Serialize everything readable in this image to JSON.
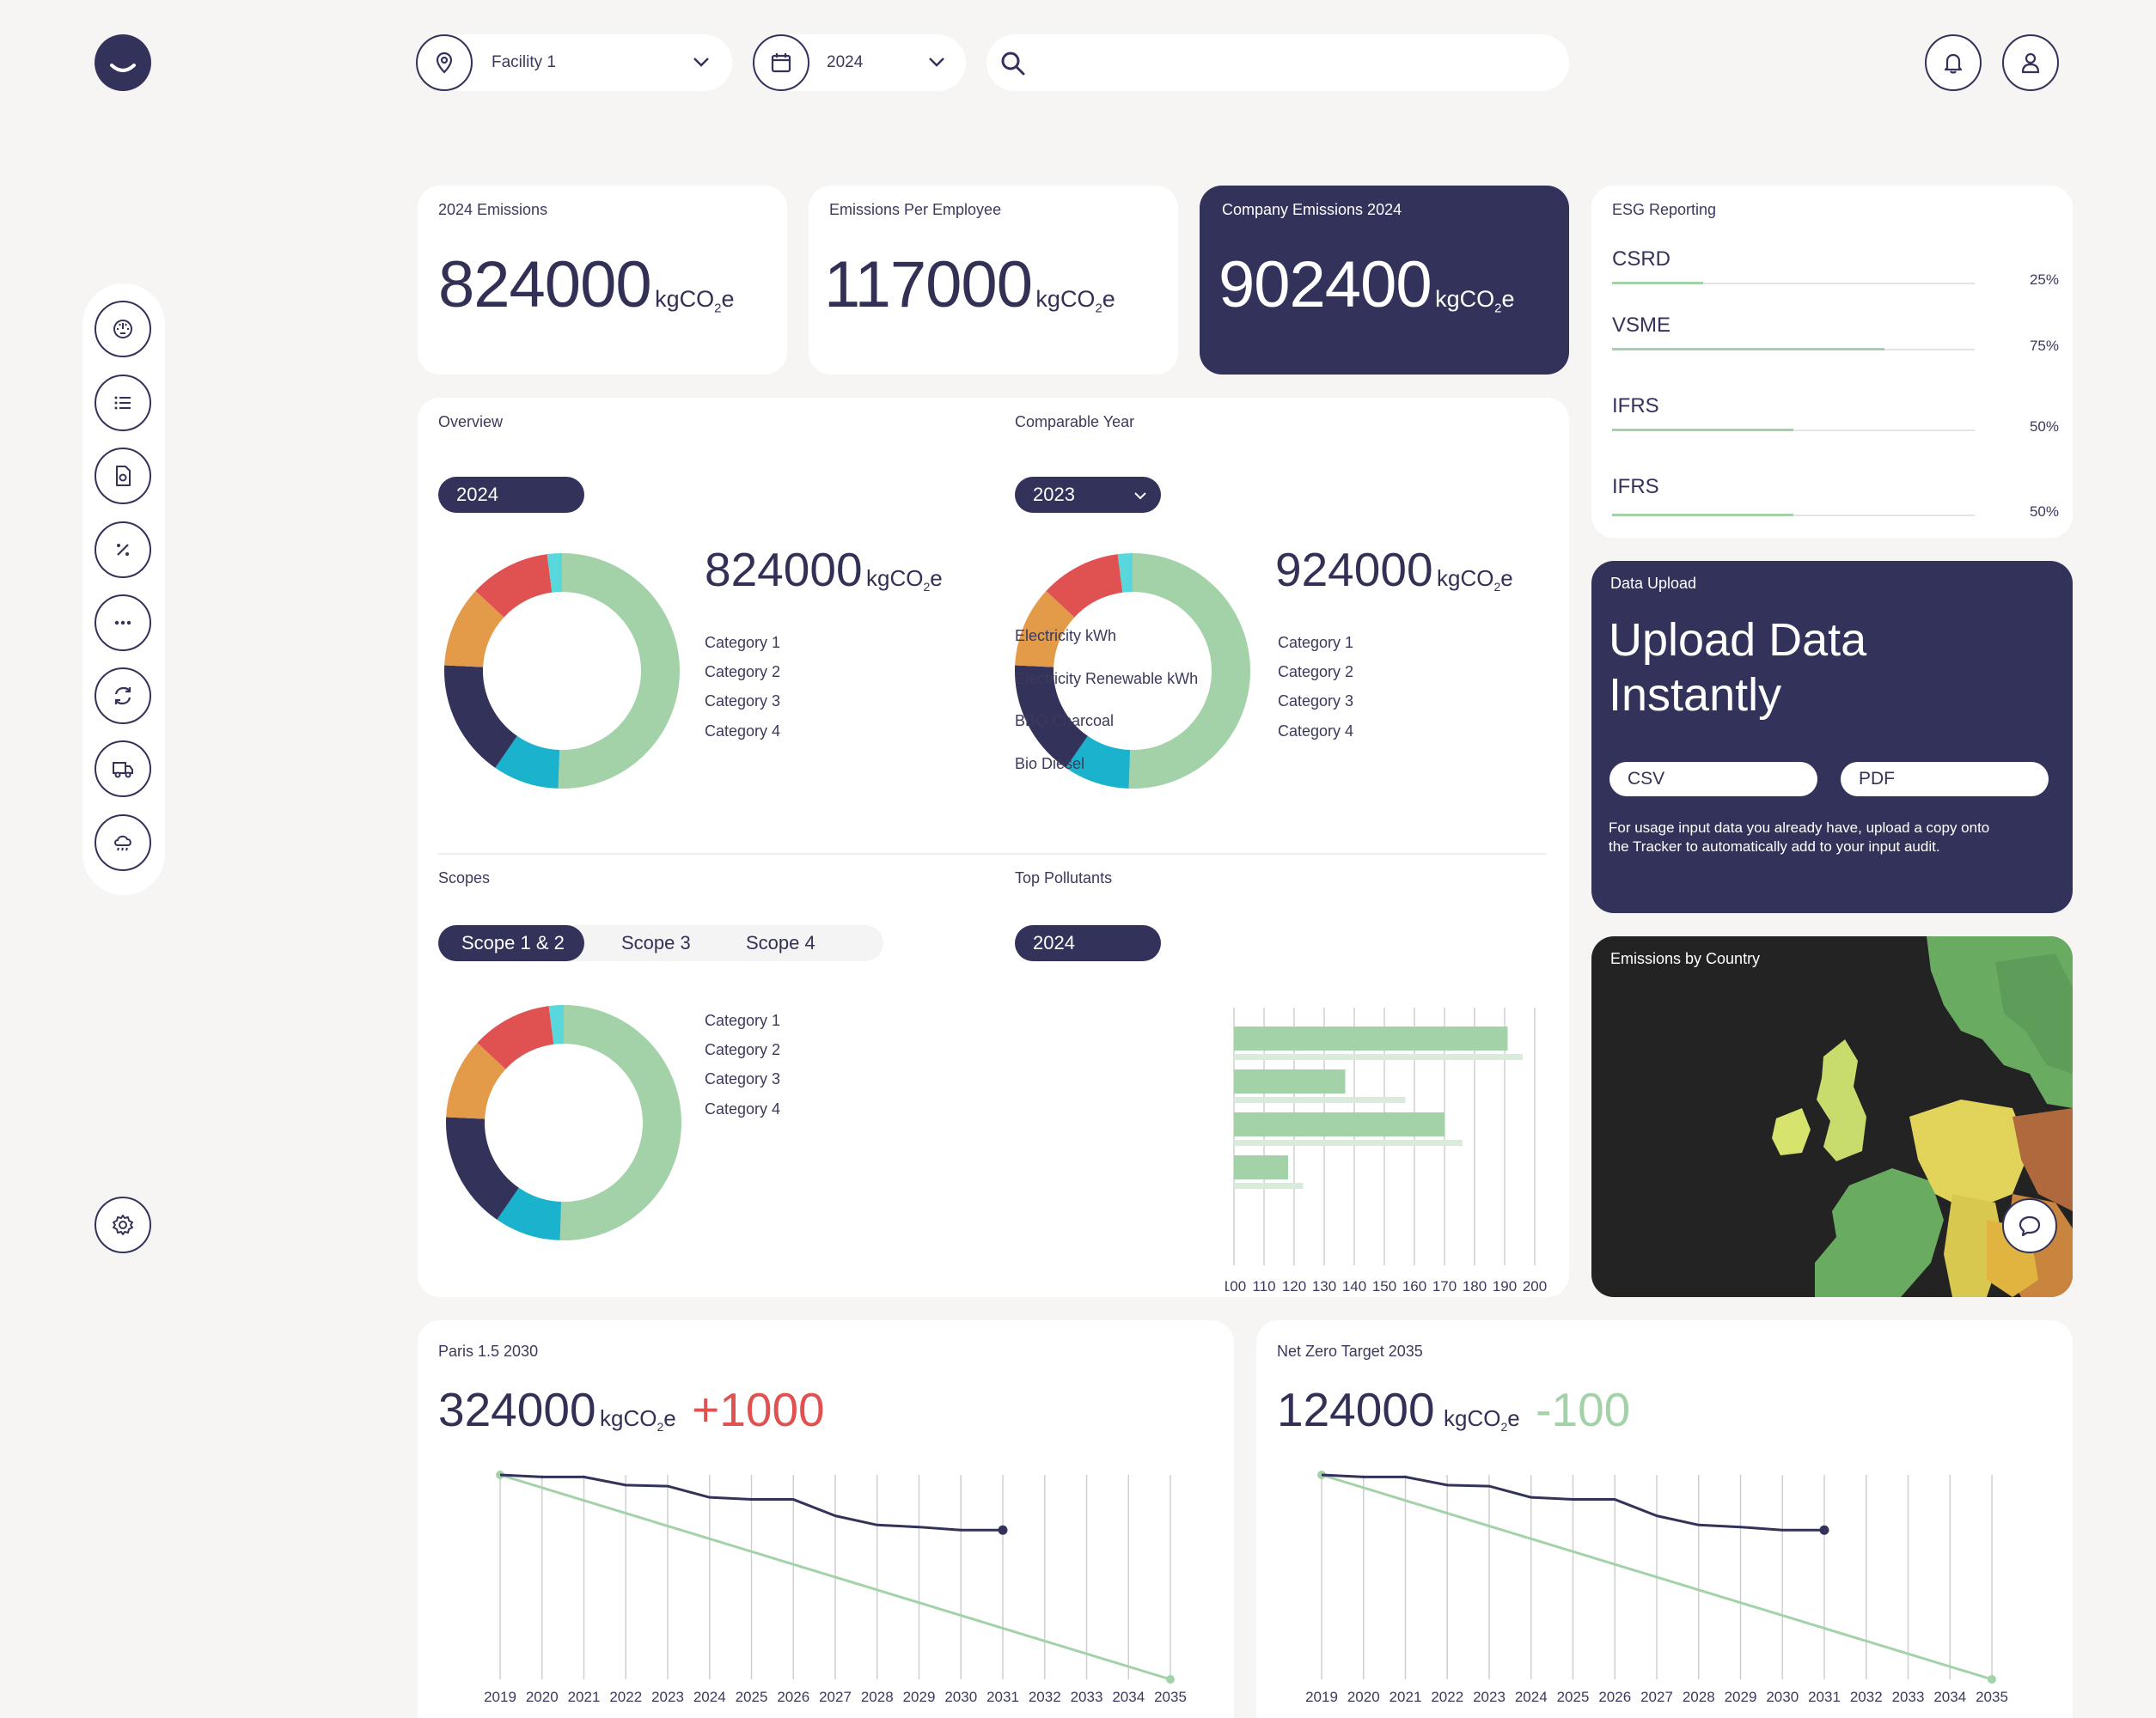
{
  "header": {
    "facility": {
      "value": "Facility 1"
    },
    "year": {
      "value": "2024"
    },
    "search": {
      "placeholder": ""
    }
  },
  "kpis": [
    {
      "label": "2024 Emissions",
      "value": "824000",
      "unit": "kgCO",
      "unit_sub": "2",
      "unit_tail": "e"
    },
    {
      "label": "Emissions Per Employee",
      "value": "117000",
      "unit": "kgCO",
      "unit_sub": "2",
      "unit_tail": "e"
    },
    {
      "label": "Company Emissions 2024",
      "value": "902400",
      "unit": "kgCO",
      "unit_sub": "2",
      "unit_tail": "e"
    }
  ],
  "esg": {
    "title": "ESG Reporting",
    "items": [
      {
        "name": "CSRD",
        "pct_label": "25%",
        "pct": 0.25
      },
      {
        "name": "VSME",
        "pct_label": "75%",
        "pct": 0.75
      },
      {
        "name": "IFRS",
        "pct_label": "50%",
        "pct": 0.5
      },
      {
        "name": "IFRS",
        "pct_label": "50%",
        "pct": 0.5
      }
    ]
  },
  "overview": {
    "title": "Overview",
    "year": "2024",
    "value": "824000",
    "unit": "kgCO",
    "unit_sub": "2",
    "unit_tail": "e",
    "categories": [
      "Category 1",
      "Category 2",
      "Category 3",
      "Category 4"
    ]
  },
  "comparable": {
    "title": "Comparable Year",
    "year": "2023",
    "value": "924000",
    "unit": "kgCO",
    "unit_sub": "2",
    "unit_tail": "e",
    "categories": [
      "Category 1",
      "Category 2",
      "Category 3",
      "Category 4"
    ]
  },
  "scopes": {
    "title": "Scopes",
    "tabs": [
      "Scope 1 & 2",
      "Scope 3",
      "Scope 4"
    ],
    "categories": [
      "Category 1",
      "Category 2",
      "Category 3",
      "Category 4"
    ]
  },
  "pollutants": {
    "title": "Top Pollutants",
    "year": "2024"
  },
  "upload": {
    "label": "Data Upload",
    "headline_line1": "Upload Data",
    "headline_line2": "Instantly",
    "csv": "CSV",
    "pdf": "PDF",
    "description_line1": "For usage input data you already have, upload a copy onto",
    "description_line2": "the Tracker to automatically add to your input audit."
  },
  "map": {
    "title": "Emissions by Country"
  },
  "paris": {
    "title": "Paris 1.5  2030",
    "value": "324000",
    "unit": "kgCO",
    "unit_sub": "2",
    "unit_tail": "e",
    "delta": "+1000"
  },
  "netzero": {
    "title": "Net Zero Target 2035",
    "value": "124000",
    "unit": "kgCO",
    "unit_sub": "2",
    "unit_tail": "e",
    "delta": "-100"
  },
  "colors": {
    "navy": "#33325a",
    "green": "#a3d2a8",
    "teal": "#1ab2cc",
    "orange": "#e39a49",
    "red": "#e05252",
    "cyan": "#58d8dc",
    "positive_delta": "#e05252",
    "negative_delta": "#a3d2a8"
  },
  "icons": {
    "sidebar": [
      "gauge-icon",
      "list-icon",
      "document-icon",
      "percent-icon",
      "more-icon",
      "refresh-icon",
      "truck-icon",
      "cloud-icon"
    ],
    "settings": "gear-icon"
  },
  "chart_data": [
    {
      "type": "pie",
      "id": "overview-donut",
      "categories": [
        "Category 1",
        "Category 2",
        "Category 3",
        "Category 4"
      ],
      "slices": [
        {
          "value": 50,
          "color": "#a3d2a8"
        },
        {
          "value": 9,
          "color": "#1ab2cc"
        },
        {
          "value": 16,
          "color": "#33325a"
        },
        {
          "value": 11,
          "color": "#e39a49"
        },
        {
          "value": 11,
          "color": "#e05252"
        },
        {
          "value": 2,
          "color": "#58d8dc"
        }
      ]
    },
    {
      "type": "pie",
      "id": "comparable-donut",
      "categories": [
        "Category 1",
        "Category 2",
        "Category 3",
        "Category 4"
      ],
      "slices": [
        {
          "value": 50,
          "color": "#a3d2a8"
        },
        {
          "value": 9,
          "color": "#1ab2cc"
        },
        {
          "value": 16,
          "color": "#33325a"
        },
        {
          "value": 11,
          "color": "#e39a49"
        },
        {
          "value": 11,
          "color": "#e05252"
        },
        {
          "value": 2,
          "color": "#58d8dc"
        }
      ]
    },
    {
      "type": "pie",
      "id": "scopes-donut",
      "categories": [
        "Category 1",
        "Category 2",
        "Category 3",
        "Category 4"
      ],
      "slices": [
        {
          "value": 50,
          "color": "#a3d2a8"
        },
        {
          "value": 9,
          "color": "#1ab2cc"
        },
        {
          "value": 16,
          "color": "#33325a"
        },
        {
          "value": 11,
          "color": "#e39a49"
        },
        {
          "value": 11,
          "color": "#e05252"
        },
        {
          "value": 2,
          "color": "#58d8dc"
        }
      ]
    },
    {
      "type": "bar",
      "id": "pollutants-bars",
      "orientation": "horizontal",
      "categories": [
        "Electricity kWh",
        "Electricity Renewable kWh",
        "BBQ Charcoal",
        "Bio Diesel"
      ],
      "series": [
        {
          "values": [
            191,
            137,
            170,
            118
          ],
          "color": "#a3d2a8"
        },
        {
          "values": [
            196,
            157,
            176,
            123
          ],
          "color": "#d9ecdb"
        }
      ],
      "xticks": [
        "100",
        "110",
        "120",
        "130",
        "140",
        "150",
        "160",
        "170",
        "180",
        "190",
        "200"
      ],
      "xlim": [
        100,
        200
      ]
    },
    {
      "type": "line",
      "id": "paris-line",
      "x": [
        "2019",
        "2020",
        "2021",
        "2022",
        "2023",
        "2024",
        "2025",
        "2026",
        "2027",
        "2028",
        "2029",
        "2030",
        "2031",
        "2032",
        "2033",
        "2034",
        "2035"
      ],
      "series": [
        {
          "values": [
            100,
            99,
            99,
            95,
            94.5,
            89,
            88,
            88,
            80,
            75.5,
            74.5,
            73,
            73
          ],
          "color": "#33325a"
        },
        {
          "values": [
            100,
            0
          ],
          "x_index": [
            0,
            16
          ],
          "color": "#a3d2a8"
        }
      ],
      "ylim": [
        0,
        100
      ]
    },
    {
      "type": "line",
      "id": "netzero-line",
      "x": [
        "2019",
        "2020",
        "2021",
        "2022",
        "2023",
        "2024",
        "2025",
        "2026",
        "2027",
        "2028",
        "2029",
        "2030",
        "2031",
        "2032",
        "2033",
        "2034",
        "2035"
      ],
      "series": [
        {
          "values": [
            100,
            99,
            99,
            95,
            94.5,
            89,
            88,
            88,
            80,
            75.5,
            74.5,
            73,
            73
          ],
          "color": "#33325a"
        },
        {
          "values": [
            100,
            0
          ],
          "x_index": [
            0,
            16
          ],
          "color": "#a3d2a8"
        }
      ],
      "ylim": [
        0,
        100
      ]
    }
  ]
}
